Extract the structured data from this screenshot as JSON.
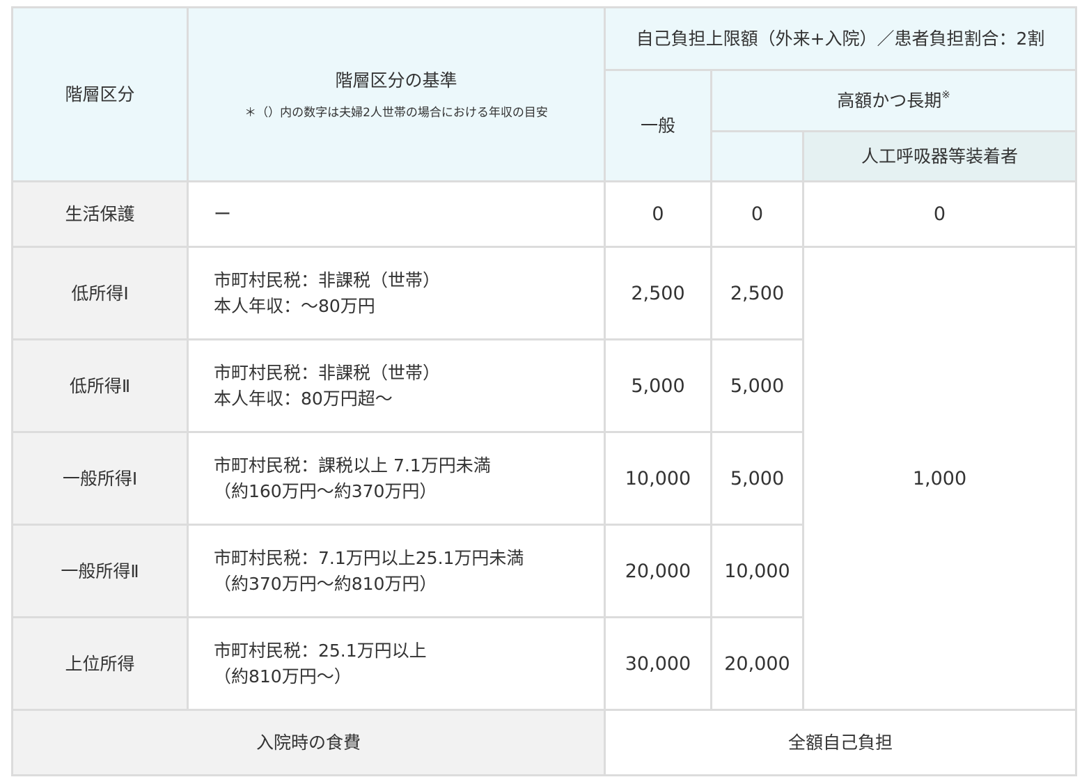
{
  "header": {
    "tier": "階層区分",
    "criteria_title": "階層区分の基準",
    "criteria_note": "＊（）内の数字は夫婦2人世帯の場合における年収の目安",
    "limit_group": "自己負担上限額（外来+入院）／患者負担割合：2割",
    "general": "一般",
    "high_long": "高額かつ長期",
    "high_long_mark": "※",
    "ventilator": "人工呼吸器等装着者"
  },
  "rows": [
    {
      "tier": "生活保護",
      "criteria": [
        "ー"
      ],
      "general": "0",
      "high_long": "0"
    },
    {
      "tier": "低所得Ⅰ",
      "criteria": [
        "市町村民税：非課税（世帯）",
        "本人年収：～80万円"
      ],
      "general": "2,500",
      "high_long": "2,500"
    },
    {
      "tier": "低所得Ⅱ",
      "criteria": [
        "市町村民税：非課税（世帯）",
        "本人年収：80万円超～"
      ],
      "general": "5,000",
      "high_long": "5,000"
    },
    {
      "tier": "一般所得Ⅰ",
      "criteria": [
        "市町村民税：課税以上 7.1万円未満",
        "（約160万円～約370万円）"
      ],
      "general": "10,000",
      "high_long": "5,000"
    },
    {
      "tier": "一般所得Ⅱ",
      "criteria": [
        "市町村民税：7.1万円以上25.1万円未満",
        "（約370万円～約810万円）"
      ],
      "general": "20,000",
      "high_long": "10,000"
    },
    {
      "tier": "上位所得",
      "criteria": [
        "市町村民税：25.1万円以上",
        "（約810万円～）"
      ],
      "general": "30,000",
      "high_long": "20,000"
    }
  ],
  "ventilator_values": {
    "welfare": "0",
    "others": "1,000"
  },
  "footer": {
    "label": "入院時の食費",
    "value": "全額自己負担"
  }
}
